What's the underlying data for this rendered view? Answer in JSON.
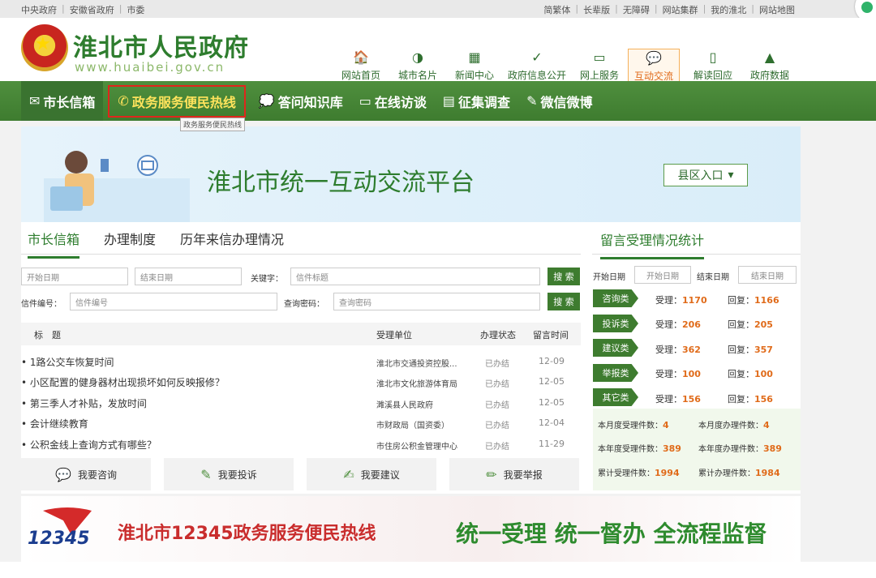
{
  "topbar": {
    "left": [
      "中央政府",
      "安徽省政府",
      "市委"
    ],
    "right": [
      "简繁体",
      "长辈版",
      "无障碍",
      "网站集群",
      "我的淮北",
      "网站地图"
    ]
  },
  "header": {
    "title": "淮北市人民政府",
    "url": "www.huaibei.gov.cn"
  },
  "nav": [
    {
      "label": "网站首页",
      "icon": "🏠"
    },
    {
      "label": "城市名片",
      "icon": "◑"
    },
    {
      "label": "新闻中心",
      "icon": "▦"
    },
    {
      "label": "政府信息公开",
      "icon": "✓"
    },
    {
      "label": "网上服务",
      "icon": "▭"
    },
    {
      "label": "互动交流",
      "icon": "💬"
    },
    {
      "label": "解读回应",
      "icon": "▯"
    },
    {
      "label": "政府数据",
      "icon": "▲"
    }
  ],
  "subnav": [
    {
      "label": "市长信箱",
      "icon": "✉"
    },
    {
      "label": "政务服务便民热线",
      "icon": "✆"
    },
    {
      "label": "答问知识库",
      "icon": "💭"
    },
    {
      "label": "在线访谈",
      "icon": "▭"
    },
    {
      "label": "征集调查",
      "icon": "▤"
    },
    {
      "label": "微信微博",
      "icon": "✎"
    }
  ],
  "tooltip": "政务服务便民热线",
  "banner": {
    "title": "淮北市统一互动交流平台",
    "county_btn": "县区入口"
  },
  "tabs": [
    "市长信箱",
    "办理制度",
    "历年来信办理情况"
  ],
  "search": {
    "start_ph": "开始日期",
    "end_ph": "结束日期",
    "keyword_label": "关键字：",
    "keyword_ph": "信件标题",
    "btn": "搜 索",
    "code_label": "信件编号：",
    "code_ph": "信件编号",
    "pwd_label": "查询密码：",
    "pwd_ph": "查询密码"
  },
  "table": {
    "headers": [
      "标　题",
      "受理单位",
      "办理状态",
      "留言时间"
    ],
    "rows": [
      {
        "title": "1路公交车恢复时间",
        "unit": "淮北市交通投资控股...",
        "status": "已办结",
        "date": "12-09"
      },
      {
        "title": "小区配置的健身器材出现损坏如何反映报修？",
        "unit": "淮北市文化旅游体育局",
        "status": "已办结",
        "date": "12-05"
      },
      {
        "title": "第三季人才补贴，发放时间",
        "unit": "濉溪县人民政府",
        "status": "已办结",
        "date": "12-05"
      },
      {
        "title": "会计继续教育",
        "unit": "市财政局（国资委）",
        "status": "已办结",
        "date": "12-04"
      },
      {
        "title": "公积金线上查询方式有哪些？",
        "unit": "市住房公积金管理中心",
        "status": "已办结",
        "date": "11-29"
      }
    ]
  },
  "actions": [
    {
      "label": "我要咨询",
      "icon": "💬"
    },
    {
      "label": "我要投诉",
      "icon": "✎"
    },
    {
      "label": "我要建议",
      "icon": "✍"
    },
    {
      "label": "我要举报",
      "icon": "✏"
    }
  ],
  "stats": {
    "title": "留言受理情况统计",
    "start_label": "开始日期",
    "start_ph": "开始日期",
    "end_label": "结束日期",
    "end_ph": "结束日期",
    "accept_label": "受理：",
    "reply_label": "回复：",
    "rows": [
      {
        "name": "咨询类",
        "accept": "1170",
        "reply": "1166"
      },
      {
        "name": "投诉类",
        "accept": "206",
        "reply": "205"
      },
      {
        "name": "建议类",
        "accept": "362",
        "reply": "357"
      },
      {
        "name": "举报类",
        "accept": "100",
        "reply": "100"
      },
      {
        "name": "其它类",
        "accept": "156",
        "reply": "156"
      }
    ],
    "summary": [
      {
        "label": "本月度受理件数：",
        "value": "4"
      },
      {
        "label": "本月度办理件数：",
        "value": "4"
      },
      {
        "label": "本年度受理件数：",
        "value": "389"
      },
      {
        "label": "本年度办理件数：",
        "value": "389"
      },
      {
        "label": "累计受理件数：",
        "value": "1994"
      },
      {
        "label": "累计办理件数：",
        "value": "1984"
      }
    ]
  },
  "hotline": {
    "logo": "12345",
    "title": "淮北市12345政务服务便民热线",
    "slogan": "统一受理 统一督办 全流程监督"
  }
}
